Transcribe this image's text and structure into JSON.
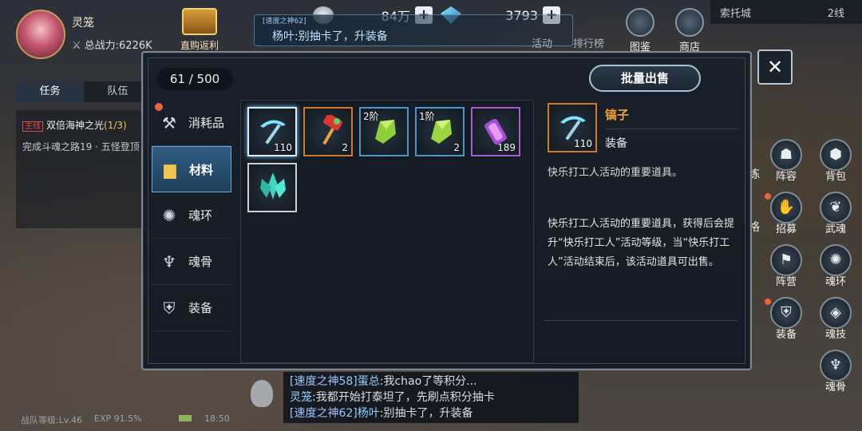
{
  "player": {
    "name": "灵笼",
    "power_label": "总战力:6226K"
  },
  "gift": {
    "label": "直购返利"
  },
  "currency": [
    {
      "icon": "silver-coin-icon",
      "value": "84万"
    },
    {
      "icon": "diamond-icon",
      "value": "3793"
    }
  ],
  "broadcast": {
    "tag": "[速度之神62]",
    "text": "杨叶:别抽卡了，升装备"
  },
  "top_icons": [
    {
      "label": "图鉴"
    },
    {
      "label": "商店"
    }
  ],
  "top_ghost_labels": [
    "活动",
    "排行榜"
  ],
  "map": {
    "name": "索托城",
    "line": "2线"
  },
  "quest": {
    "tabs": [
      "任务",
      "队伍"
    ],
    "main_tag": "主线",
    "title": "双倍海神之光",
    "progress": "(1/3)",
    "desc": "完成斗魂之路19 · 五怪登顶"
  },
  "side_icons": [
    {
      "label": "阵容",
      "icon": "team-icon"
    },
    {
      "label": "背包",
      "icon": "bag-icon"
    },
    {
      "label": "招募",
      "icon": "recruit-icon"
    },
    {
      "label": "武魂",
      "icon": "martial-soul-icon"
    },
    {
      "label": "阵营",
      "icon": "camp-icon"
    },
    {
      "label": "魂环",
      "icon": "soul-ring-icon"
    },
    {
      "label": "装备",
      "icon": "equipment-icon"
    },
    {
      "label": "魂技",
      "icon": "soul-skill-icon"
    },
    {
      "label": "魂骨",
      "icon": "soul-bone-icon"
    }
  ],
  "side_partial_labels": [
    "练",
    "格"
  ],
  "chat": [
    {
      "channel": "[速度之神58]",
      "name": "蛋总",
      "text": ":我chao了等积分..."
    },
    {
      "channel": "",
      "name": "灵笼",
      "text": ":我都开始打泰坦了，先刷点积分抽卡"
    },
    {
      "channel": "[速度之神62]",
      "name": "杨叶",
      "text": ":别抽卡了，升装备"
    }
  ],
  "status": {
    "level": "战队等级:Lv.46",
    "exp": "EXP 91.5%",
    "time": "18:50"
  },
  "inventory": {
    "capacity": "61 / 500",
    "bulk_sell": "批量出售",
    "close": "✕",
    "categories": [
      {
        "label": "消耗品",
        "icon": "consumable-icon",
        "badge": true
      },
      {
        "label": "材料",
        "icon": "anvil-icon",
        "active": true
      },
      {
        "label": "魂环",
        "icon": "soul-ring-icon"
      },
      {
        "label": "魂骨",
        "icon": "soul-bone-icon"
      },
      {
        "label": "装备",
        "icon": "equipment-icon"
      }
    ],
    "items": [
      {
        "name": "pickaxe",
        "qty": "110",
        "tier": "",
        "rarity": "white-selected"
      },
      {
        "name": "red-hammer",
        "qty": "2",
        "tier": "",
        "rarity": "orange"
      },
      {
        "name": "green-crystal",
        "qty": "",
        "tier": "2阶",
        "rarity": "blue"
      },
      {
        "name": "green-crystal",
        "qty": "2",
        "tier": "1阶",
        "rarity": "blue"
      },
      {
        "name": "purple-scroll",
        "qty": "189",
        "tier": "",
        "rarity": "purple"
      },
      {
        "name": "teal-crystal-cluster",
        "qty": "",
        "tier": "",
        "rarity": "white"
      }
    ],
    "detail": {
      "name": "镐子",
      "qty": "110",
      "type": "装备",
      "short_desc": "快乐打工人活动的重要道具。",
      "long_desc": "快乐打工人活动的重要道具，获得后会提升“快乐打工人”活动等级，当“快乐打工人”活动结束后，该活动道具可出售。"
    }
  },
  "colors": {
    "accent_orange": "#f0a23a",
    "active_tab": "#2f5e83",
    "badge_red": "#e8643a"
  }
}
